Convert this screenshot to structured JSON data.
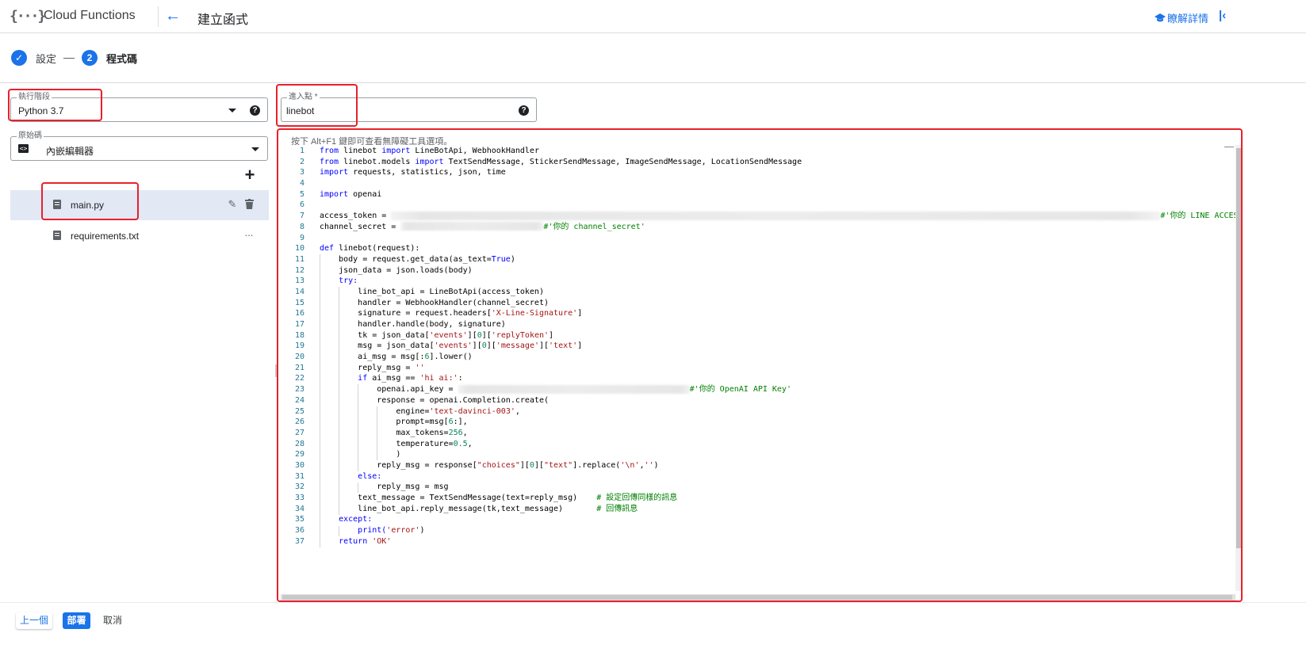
{
  "header": {
    "logo": "{···}",
    "app_title": "Cloud Functions",
    "back_icon": "arrow-left-icon",
    "page_title": "建立函式",
    "learn_more": "瞭解詳情",
    "collapse_icon": "collapse-panel-icon"
  },
  "stepper": {
    "step1_label": "設定",
    "step2_number": "2",
    "step2_label": "程式碼"
  },
  "left_panel": {
    "runtime": {
      "label": "執行階段",
      "value": "Python 3.7"
    },
    "source": {
      "label": "原始碼",
      "value": "內嵌編輯器"
    },
    "add_icon": "+",
    "files": [
      {
        "name": "main.py",
        "selected": true
      },
      {
        "name": "requirements.txt",
        "selected": false
      }
    ],
    "more_icon": "..."
  },
  "entry_point": {
    "label": "進入點 *",
    "value": "linebot",
    "help": "?"
  },
  "editor": {
    "hint": "按下 Alt+F1 鍵即可查看無障礙工具選項。",
    "line_numbers": [
      "1",
      "2",
      "3",
      "4",
      "5",
      "6",
      "7",
      "8",
      "9",
      "10",
      "11",
      "12",
      "13",
      "14",
      "15",
      "16",
      "17",
      "18",
      "19",
      "20",
      "21",
      "22",
      "23",
      "24",
      "25",
      "26",
      "27",
      "28",
      "29",
      "30",
      "31",
      "32",
      "33",
      "34",
      "35",
      "36",
      "37"
    ],
    "code": {
      "l1a": "from",
      "l1b": " linebot ",
      "l1c": "import",
      "l1d": " LineBotApi, WebhookHandler",
      "l2a": "from",
      "l2b": " linebot.models ",
      "l2c": "import",
      "l2d": " TextSendMessage, StickerSendMessage, ImageSendMessage, LocationSendMessage",
      "l3a": "import",
      "l3b": " requests, statistics, json, time",
      "l5a": "import",
      "l5b": " openai",
      "l7a": "access_token = ",
      "l7c": "#'你的 LINE ACCESS",
      "l8a": "channel_secret = ",
      "l8c": "#'你的 channel_secret'",
      "l10a": "def",
      "l10b": " linebot(request):",
      "l11a": "body = request.get_data(as_text=",
      "l11b": "True",
      "l11c": ")",
      "l12": "json_data = json.loads(body)",
      "l13": "try:",
      "l14": "line_bot_api = LineBotApi(access_token)",
      "l15": "handler = WebhookHandler(channel_secret)",
      "l16a": "signature = request.headers[",
      "l16b": "'X-Line-Signature'",
      "l16c": "]",
      "l17": "handler.handle(body, signature)",
      "l18a": "tk = json_data[",
      "l18b": "'events'",
      "l18c": "][",
      "l18d": "0",
      "l18e": "][",
      "l18f": "'replyToken'",
      "l18g": "]",
      "l19a": "msg = json_data[",
      "l19b": "'events'",
      "l19c": "][",
      "l19d": "0",
      "l19e": "][",
      "l19f": "'message'",
      "l19g": "][",
      "l19h": "'text'",
      "l19i": "]",
      "l20a": "ai_msg = msg[:",
      "l20b": "6",
      "l20c": "].lower()",
      "l21a": "reply_msg = ",
      "l21b": "''",
      "l22a": "if",
      "l22b": " ai_msg == ",
      "l22c": "'hi ai:'",
      "l22d": ":",
      "l23a": "openai.api_key = ",
      "l23c": "#'你的 OpenAI API Key'",
      "l24": "response = openai.Completion.create(",
      "l25a": "engine=",
      "l25b": "'text-davinci-003'",
      "l25c": ",",
      "l26a": "prompt=msg[",
      "l26b": "6",
      "l26c": ":],",
      "l27a": "max_tokens=",
      "l27b": "256",
      "l27c": ",",
      "l28a": "temperature=",
      "l28b": "0.5",
      "l28c": ",",
      "l29": ")",
      "l30a": "reply_msg = response[",
      "l30b": "\"choices\"",
      "l30c": "][",
      "l30d": "0",
      "l30e": "][",
      "l30f": "\"text\"",
      "l30g": "].replace(",
      "l30h": "'\\n'",
      "l30i": ",",
      "l30j": "''",
      "l30k": ")",
      "l31": "else:",
      "l32": "reply_msg = msg",
      "l33a": "text_message = TextSendMessage(text=reply_msg)    ",
      "l33b": "# 設定回傳同樣的訊息",
      "l34a": "line_bot_api.reply_message(tk,text_message)       ",
      "l34b": "# 回傳訊息",
      "l35": "except:",
      "l36a": "print(",
      "l36b": "'error'",
      "l36c": ")",
      "l37a": "return",
      "l37b": " ",
      "l37c": "'OK'"
    }
  },
  "footer": {
    "prev": "上一個",
    "deploy": "部署",
    "cancel": "取消"
  }
}
